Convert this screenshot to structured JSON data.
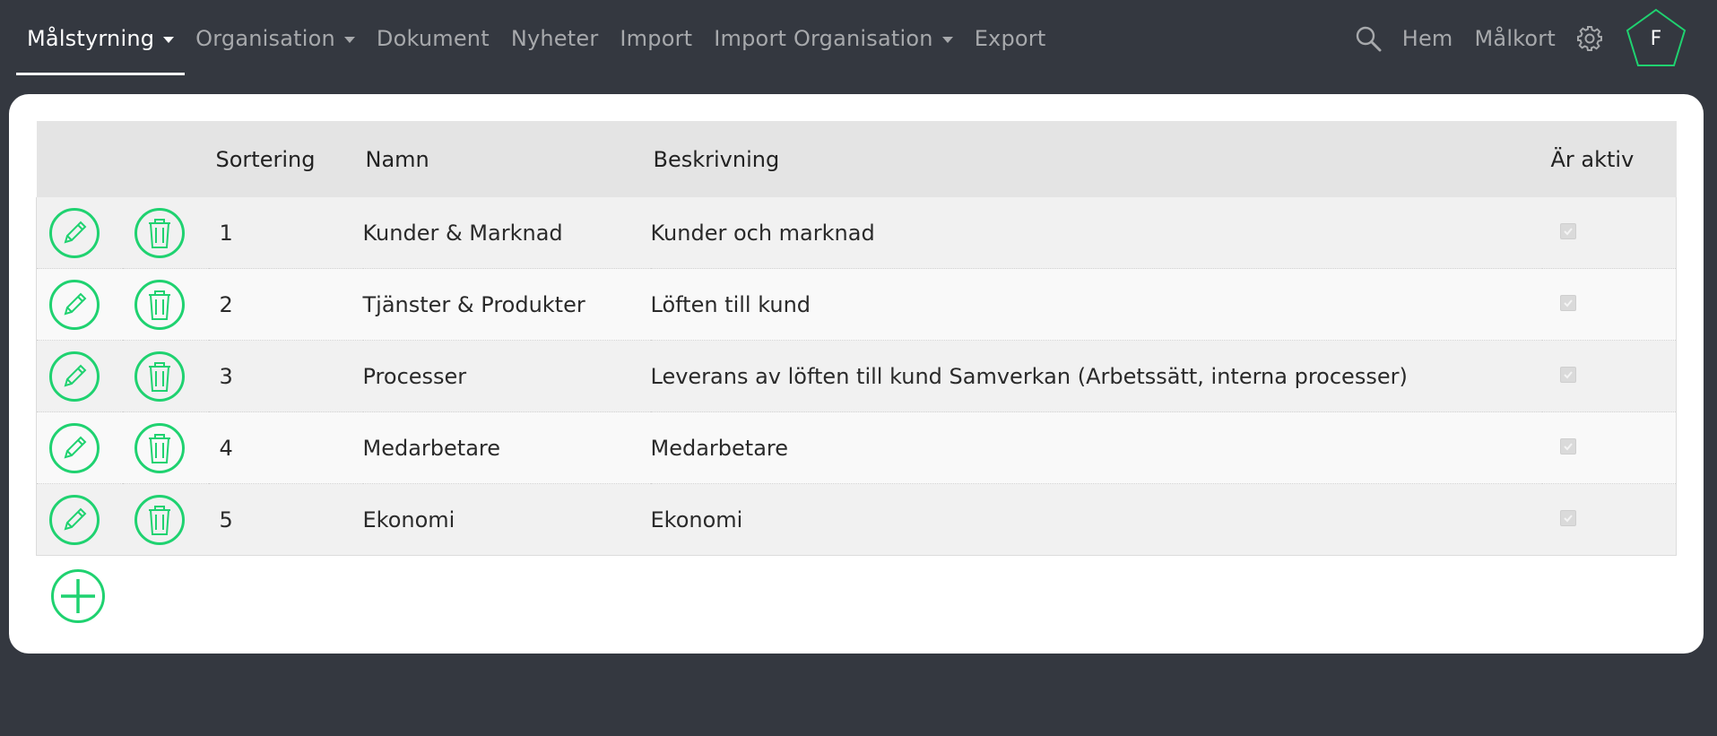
{
  "nav": {
    "items": [
      {
        "label": "Målstyrning",
        "dropdown": true,
        "active": true
      },
      {
        "label": "Organisation",
        "dropdown": true,
        "active": false
      },
      {
        "label": "Dokument",
        "dropdown": false,
        "active": false
      },
      {
        "label": "Nyheter",
        "dropdown": false,
        "active": false
      },
      {
        "label": "Import",
        "dropdown": false,
        "active": false
      },
      {
        "label": "Import Organisation",
        "dropdown": true,
        "active": false
      },
      {
        "label": "Export",
        "dropdown": false,
        "active": false
      }
    ],
    "right": {
      "search_icon": "search-icon",
      "home_label": "Hem",
      "scorecard_label": "Målkort",
      "settings_icon": "gear-icon",
      "avatar_letter": "F"
    }
  },
  "table": {
    "headers": {
      "sort": "Sortering",
      "name": "Namn",
      "description": "Beskrivning",
      "active": "Är aktiv"
    },
    "rows": [
      {
        "sort": "1",
        "name": "Kunder & Marknad",
        "description": "Kunder och marknad",
        "active": true
      },
      {
        "sort": "2",
        "name": "Tjänster & Produkter",
        "description": "Löften till kund",
        "active": true
      },
      {
        "sort": "3",
        "name": "Processer",
        "description": "Leverans av löften till kund Samverkan (Arbetssätt, interna processer)",
        "active": true
      },
      {
        "sort": "4",
        "name": "Medarbetare",
        "description": "Medarbetare",
        "active": true
      },
      {
        "sort": "5",
        "name": "Ekonomi",
        "description": "Ekonomi",
        "active": true
      }
    ]
  },
  "colors": {
    "background": "#343840",
    "accent": "#1fd270",
    "header_bg": "#e4e4e4"
  }
}
